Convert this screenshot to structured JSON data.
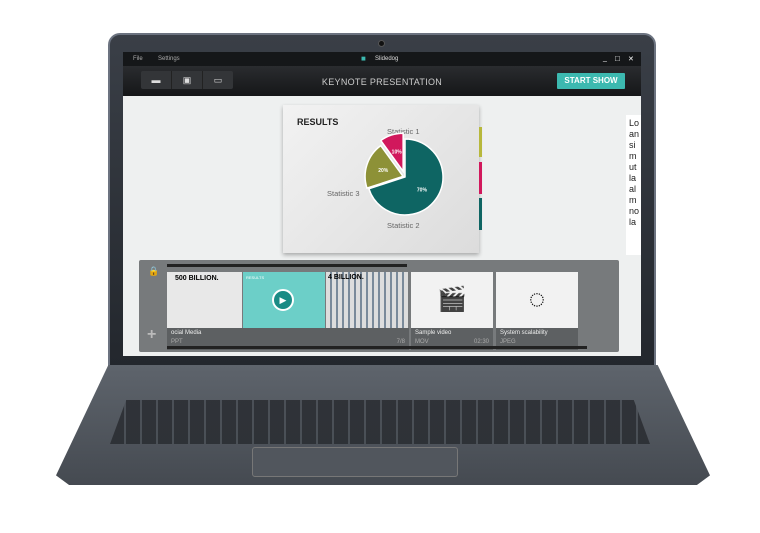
{
  "window": {
    "menu": [
      "File",
      "Settings"
    ],
    "app_name": "Slidedog",
    "controls": [
      "_",
      "□",
      "✕"
    ]
  },
  "toolbar": {
    "icons": [
      "folder-icon",
      "save-icon",
      "image-icon"
    ],
    "title": "KEYNOTE PRESENTATION",
    "start_label": "START SHOW"
  },
  "slide": {
    "title": "RESULTS",
    "labels": [
      "Statistic 1",
      "Statistic 2",
      "Statistic 3"
    ],
    "pie": [
      {
        "label": "70%",
        "value": 70,
        "color": "#0e6563"
      },
      {
        "label": "20%",
        "value": 20,
        "color": "#8d9137"
      },
      {
        "label": "10%",
        "value": 10,
        "color": "#d1185c"
      }
    ],
    "side_bars": [
      "#b7b83c",
      "#d1185c",
      "#0e6563"
    ]
  },
  "notes": {
    "text": "Lo an si m ut la al m no la"
  },
  "playlist": {
    "items": [
      {
        "name": "ocial Media",
        "type": "PPT",
        "pos": "7/8",
        "thumbs": [
          "500 BILLION.",
          "RESULTS",
          "4 BILLION."
        ]
      },
      {
        "name": "Sample video",
        "type": "MOV",
        "duration": "02:30"
      },
      {
        "name": "System scalability",
        "type": "JPEG"
      }
    ]
  },
  "colors": {
    "accent": "#3cb9b0"
  }
}
